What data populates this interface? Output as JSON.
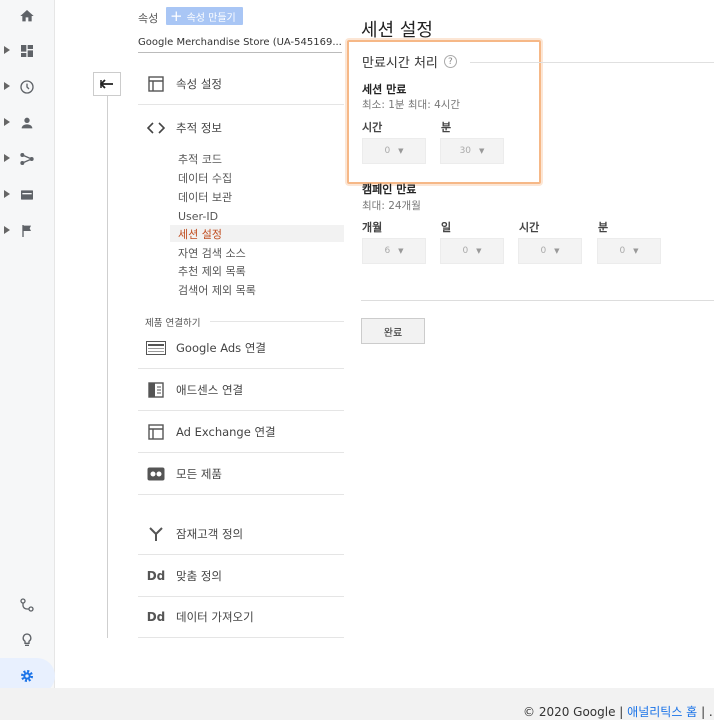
{
  "header": {
    "property_label": "속성",
    "create_property": "속성 만들기",
    "property_selector": "Google Merchandise Store (UA-545169..."
  },
  "nav": {
    "items": [
      {
        "label": "속성 설정",
        "icon": "property-settings-icon"
      },
      {
        "label": "추적 정보",
        "icon": "code-icon"
      }
    ],
    "tracking_sub": [
      "추적 코드",
      "데이터 수집",
      "데이터 보관",
      "User-ID",
      "세션 설정",
      "자연 검색 소스",
      "추천 제외 목록",
      "검색어 제외 목록"
    ],
    "active_sub": "세션 설정",
    "product_links_label": "제품 연결하기",
    "product_links": [
      {
        "label": "Google Ads 연결",
        "icon": "google-ads-icon"
      },
      {
        "label": "애드센스 연결",
        "icon": "adsense-icon"
      },
      {
        "label": "Ad Exchange 연결",
        "icon": "ad-exchange-icon"
      },
      {
        "label": "모든 제품",
        "icon": "all-products-icon"
      }
    ],
    "other_items": [
      {
        "label": "잠재고객 정의",
        "icon": "audience-icon"
      },
      {
        "label": "맞춤 정의",
        "icon": "dd-icon"
      },
      {
        "label": "데이터 가져오기",
        "icon": "dd-icon"
      }
    ]
  },
  "content": {
    "title": "세션 설정",
    "group_title": "만료시간 처리",
    "session_timeout": {
      "label": "세션 만료",
      "hint": "최소: 1분 최대: 4시간",
      "hours_label": "시간",
      "hours_value": "0",
      "minutes_label": "분",
      "minutes_value": "30"
    },
    "campaign_timeout": {
      "label": "캠페인 만료",
      "hint": "최대: 24개월",
      "months_label": "개월",
      "months_value": "6",
      "days_label": "일",
      "days_value": "0",
      "hours_label": "시간",
      "hours_value": "0",
      "minutes_label": "분",
      "minutes_value": "0"
    },
    "done_button": "완료"
  },
  "footer": {
    "copyright": "© 2020 Google |",
    "home_link": "애널리틱스 홈",
    "sep": "| ..."
  },
  "colors": {
    "accent": "#1a73e8",
    "active_link": "#c04d1f",
    "highlight": "#f6b887"
  }
}
